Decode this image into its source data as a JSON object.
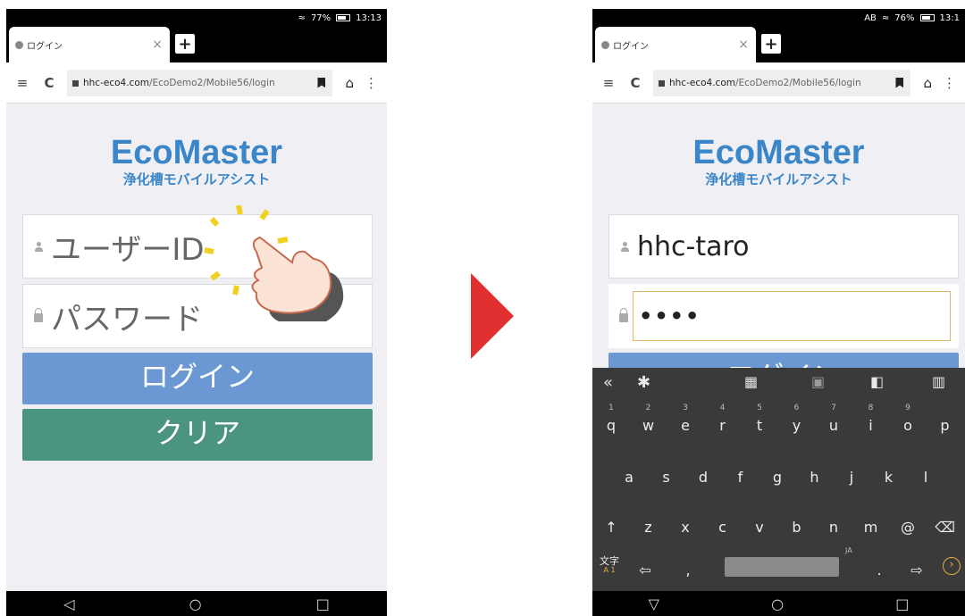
{
  "screens": {
    "before": {
      "status": {
        "wifi": "wifi-icon",
        "battery": "77%",
        "time": "13:13"
      },
      "tab": {
        "title": "ログイン",
        "close": "×",
        "new_tab": "+"
      },
      "toolbar": {
        "menu": "≡",
        "reload": "C",
        "url_domain": "hhc-eco4.com",
        "url_path": "/EcoDemo2/Mobile56/login",
        "home": "⌂",
        "more": "⋮"
      },
      "logo": {
        "brand": "EcoMaster",
        "subtitle": "浄化槽モバイルアシスト"
      },
      "form": {
        "user_placeholder": "ユーザーID",
        "password_placeholder": "パスワード",
        "login_label": "ログイン",
        "clear_label": "クリア"
      },
      "nav": {
        "back": "◁",
        "home": "○",
        "recent": "□"
      }
    },
    "after": {
      "status": {
        "ime": "AB",
        "wifi": "wifi-icon",
        "battery": "76%",
        "time": "13:1"
      },
      "tab": {
        "title": "ログイン",
        "close": "×",
        "new_tab": "+"
      },
      "toolbar": {
        "menu": "≡",
        "reload": "C",
        "url_domain": "hhc-eco4.com",
        "url_path": "/EcoDemo2/Mobile56/login",
        "home": "⌂",
        "more": "⋮"
      },
      "logo": {
        "brand": "EcoMaster",
        "subtitle": "浄化槽モバイルアシスト"
      },
      "form": {
        "user_value": "hhc-taro",
        "password_value": "••••",
        "login_label": "ログイン"
      },
      "keyboard": {
        "toolbar": [
          "«",
          "settings-icon",
          "keyboard-icon",
          "kana-icon",
          "dictionary-icon",
          "layout-icon"
        ],
        "row1": [
          {
            "num": "1",
            "ch": "q"
          },
          {
            "num": "2",
            "ch": "w"
          },
          {
            "num": "3",
            "ch": "e"
          },
          {
            "num": "4",
            "ch": "r"
          },
          {
            "num": "5",
            "ch": "t"
          },
          {
            "num": "6",
            "ch": "y"
          },
          {
            "num": "7",
            "ch": "u"
          },
          {
            "num": "8",
            "ch": "i"
          },
          {
            "num": "9",
            "ch": "o"
          },
          {
            "num": "",
            "ch": "p"
          }
        ],
        "row2": [
          "a",
          "s",
          "d",
          "f",
          "g",
          "h",
          "j",
          "k",
          "l"
        ],
        "row3": [
          "↑",
          "z",
          "x",
          "c",
          "v",
          "b",
          "n",
          "m",
          "@",
          "⌫"
        ],
        "row4": {
          "mode": "文字",
          "mode_sub": "A 1",
          "left": "⇦",
          "comma": ",",
          "ja": "JA",
          "period": ".",
          "right": "⇨",
          "enter": "›"
        }
      },
      "nav": {
        "back": "▽",
        "home": "○",
        "recent": "□"
      }
    }
  },
  "colors": {
    "brand": "#3a86c8",
    "login_button": "#6b98d3",
    "clear_button": "#4b9580",
    "arrow": "#e03030",
    "tap_burst": "#f0d020",
    "keyboard_bg": "#3a3a3a"
  }
}
